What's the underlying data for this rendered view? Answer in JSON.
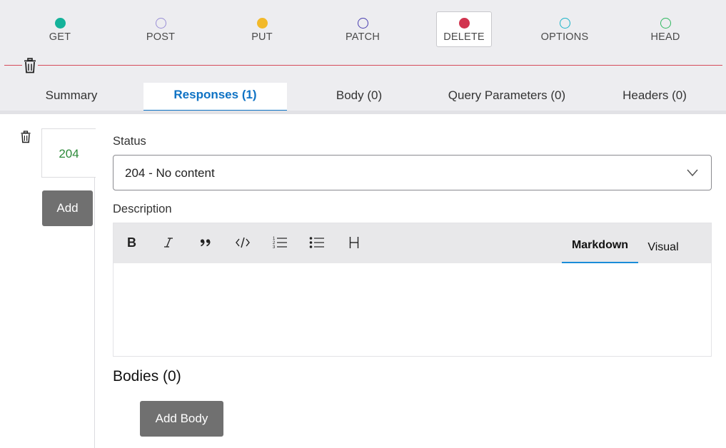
{
  "methods": [
    {
      "label": "GET",
      "color": "#14b29a",
      "filled": true,
      "selected": false
    },
    {
      "label": "POST",
      "color": "#9a8fd6",
      "filled": false,
      "selected": false
    },
    {
      "label": "PUT",
      "color": "#f2b92a",
      "filled": true,
      "selected": false
    },
    {
      "label": "PATCH",
      "color": "#4a3fb0",
      "filled": false,
      "selected": false
    },
    {
      "label": "DELETE",
      "color": "#d1344f",
      "filled": true,
      "selected": true
    },
    {
      "label": "OPTIONS",
      "color": "#1ab3c9",
      "filled": false,
      "selected": false
    },
    {
      "label": "HEAD",
      "color": "#2fb85f",
      "filled": false,
      "selected": false
    }
  ],
  "tabs": [
    {
      "label": "Summary",
      "active": false
    },
    {
      "label": "Responses (1)",
      "active": true
    },
    {
      "label": "Body (0)",
      "active": false
    },
    {
      "label": "Query Parameters (0)",
      "active": false
    },
    {
      "label": "Headers (0)",
      "active": false
    }
  ],
  "responses": {
    "items": [
      {
        "code": "204"
      }
    ],
    "add_label": "Add"
  },
  "status": {
    "label": "Status",
    "value": "204 - No content"
  },
  "description": {
    "label": "Description",
    "toolbar": [
      {
        "name": "bold-icon"
      },
      {
        "name": "italic-icon"
      },
      {
        "name": "quote-icon"
      },
      {
        "name": "code-icon"
      },
      {
        "name": "ordered-list-icon"
      },
      {
        "name": "bullet-list-icon"
      },
      {
        "name": "heading-icon"
      }
    ],
    "modes": [
      {
        "label": "Markdown",
        "active": true
      },
      {
        "label": "Visual",
        "active": false
      }
    ],
    "value": ""
  },
  "bodies": {
    "title": "Bodies (0)",
    "add_label": "Add Body"
  },
  "colors": {
    "accent": "#0e72c4",
    "divider": "#d64b5a",
    "response_code": "#2e8b3b",
    "button": "#707070"
  }
}
